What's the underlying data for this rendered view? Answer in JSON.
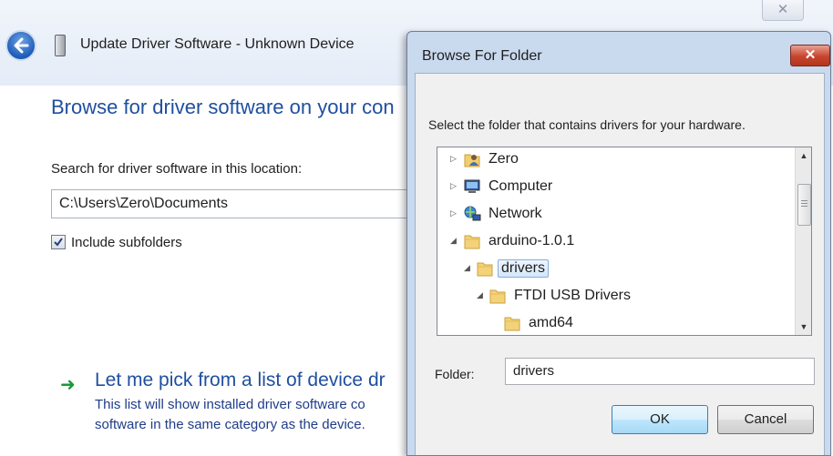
{
  "wizard": {
    "title": "Update Driver Software - Unknown Device",
    "close_glyph": "✕",
    "heading": "Browse for driver software on your con",
    "location_label": "Search for driver software in this location:",
    "location_value": "C:\\Users\\Zero\\Documents",
    "include_subfolders_label": "Include subfolders",
    "include_subfolders_checked": true,
    "pick_arrow": "➜",
    "pick_title": "Let me pick from a list of device dr",
    "pick_desc_line1": "This list will show installed driver software co",
    "pick_desc_line2": "software in the same category as the device."
  },
  "dialog": {
    "title": "Browse For Folder",
    "close_glyph": "✕",
    "instruction": "Select the folder that contains drivers for your hardware.",
    "tree": [
      {
        "label": "Zero",
        "icon": "user-folder-icon",
        "toggle": "collapsed"
      },
      {
        "label": "Computer",
        "icon": "computer-icon",
        "toggle": "collapsed"
      },
      {
        "label": "Network",
        "icon": "network-icon",
        "toggle": "collapsed"
      },
      {
        "label": "arduino-1.0.1",
        "icon": "folder-icon",
        "toggle": "expanded"
      },
      {
        "label": "drivers",
        "icon": "folder-icon",
        "toggle": "expanded",
        "selected": true
      },
      {
        "label": "FTDI USB Drivers",
        "icon": "folder-icon",
        "toggle": "expanded"
      },
      {
        "label": "amd64",
        "icon": "folder-icon",
        "toggle": "none"
      }
    ],
    "folder_label": "Folder:",
    "folder_value": "drivers",
    "ok_label": "OK",
    "cancel_label": "Cancel"
  },
  "colors": {
    "link_blue": "#1f4fa0",
    "green_arrow": "#1b9a3a",
    "close_red": "#c6452f",
    "selection_border": "#84acdd"
  }
}
